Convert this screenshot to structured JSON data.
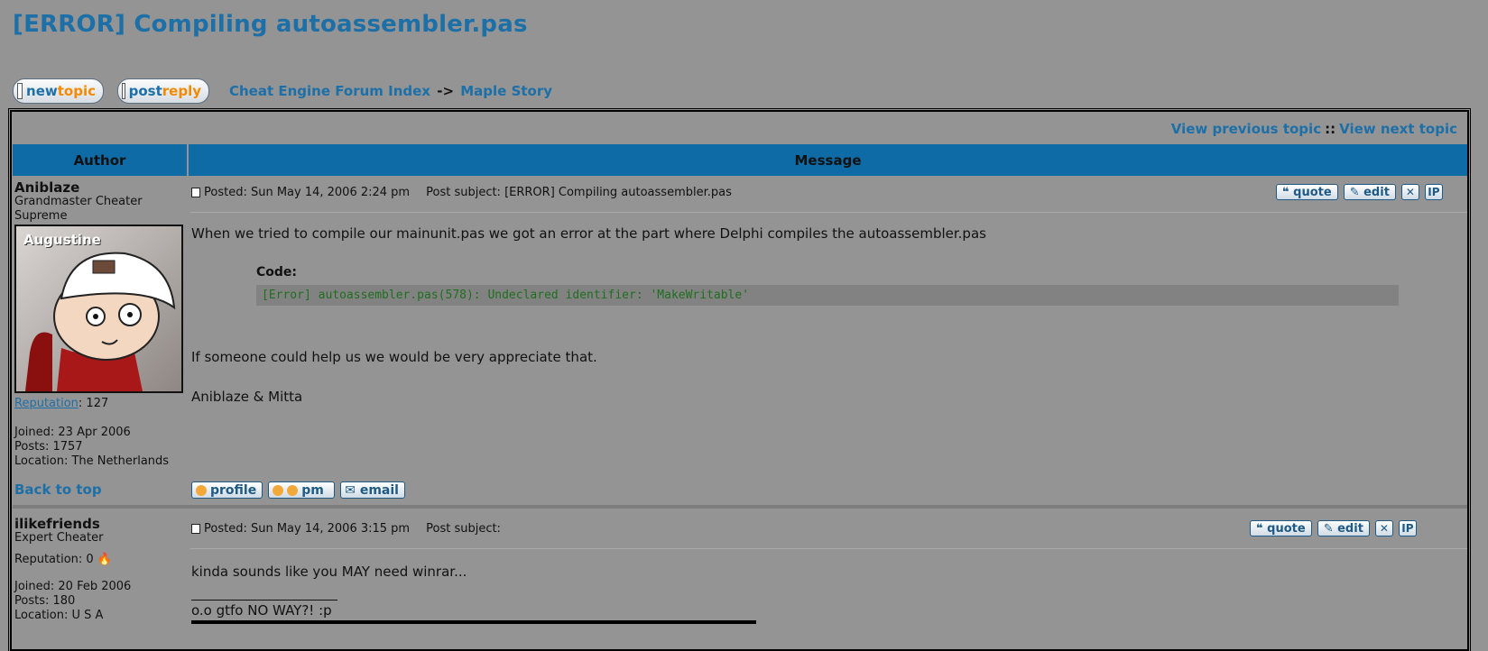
{
  "topic_title": "[ERROR] Compiling autoassembler.pas",
  "buttons": {
    "new_topic": {
      "w1": "new",
      "w2": "topic"
    },
    "post_reply": {
      "w1": "post",
      "w2": "reply"
    }
  },
  "breadcrumb": {
    "forum_index": "Cheat Engine Forum Index",
    "arrow": "->",
    "section": "Maple Story"
  },
  "topic_nav": {
    "previous": "View previous topic",
    "sep": "::",
    "next": "View next topic"
  },
  "table_headers": {
    "author": "Author",
    "message": "Message"
  },
  "posts": [
    {
      "author": "Aniblaze",
      "rank": "Grandmaster Cheater Supreme",
      "avatar_label": "Augustine",
      "reputation_label": "Reputation",
      "reputation_value": ": 127",
      "joined": "Joined: 23 Apr 2006",
      "posts": "Posts: 1757",
      "location": "Location: The Netherlands",
      "back_to_top": "Back to top",
      "posted": "Posted: Sun May 14, 2006 2:24 pm",
      "subject": "Post subject: [ERROR] Compiling autoassembler.pas",
      "body_line1": "When we tried to compile our mainunit.pas we got an error at the part where Delphi compiles the autoassembler.pas",
      "code_label": "Code:",
      "code": "[Error] autoassembler.pas(578): Undeclared identifier: 'MakeWritable'",
      "body_line2": "If someone could help us we would be very appreciate that.",
      "body_line3": "Aniblaze & Mitta",
      "profile_buttons": [
        "profile",
        "pm",
        "email"
      ]
    },
    {
      "author": "ilikefriends",
      "rank": "Expert Cheater",
      "reputation": "Reputation: 0",
      "joined": "Joined: 20 Feb 2006",
      "posts": "Posts: 180",
      "location": "Location: U S A",
      "posted": "Posted: Sun May 14, 2006 3:15 pm",
      "subject": "Post subject:",
      "body_line1": "kinda sounds like you MAY need winrar...",
      "signature": "o.o gtfo NO WAY?! :p"
    }
  ],
  "action_buttons": {
    "quote": "quote",
    "edit": "edit",
    "delete": "✕",
    "ip": "IP"
  }
}
